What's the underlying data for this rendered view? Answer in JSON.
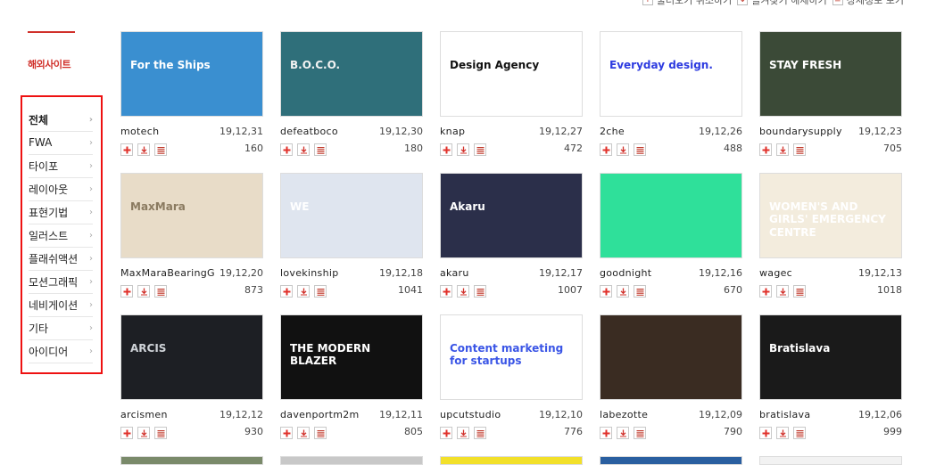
{
  "topbar": {
    "items": [
      "불러오기 취소하기",
      "즐겨찾기 해제하기",
      "상세정보 보기"
    ]
  },
  "sidebar": {
    "title": "해외사이트",
    "categories": [
      "전체",
      "FWA",
      "타이포",
      "레이아웃",
      "표현기법",
      "일러스트",
      "플래쉬액션",
      "모션그래픽",
      "네비게이션",
      "기타",
      "아이디어"
    ]
  },
  "cards": [
    {
      "name": "motech",
      "date": "19,12,31",
      "count": "160",
      "thumb": {
        "bg": "#3a8fd0",
        "text": "For the Ships",
        "fg": "#ffffff"
      }
    },
    {
      "name": "defeatboco",
      "date": "19,12,30",
      "count": "180",
      "thumb": {
        "bg": "#2f6f7a",
        "text": "B.O.C.O.",
        "fg": "#f3f3f3"
      }
    },
    {
      "name": "knap",
      "date": "19,12,27",
      "count": "472",
      "thumb": {
        "bg": "#ffffff",
        "text": "Design Agency",
        "fg": "#111111"
      }
    },
    {
      "name": "2che",
      "date": "19,12,26",
      "count": "488",
      "thumb": {
        "bg": "#ffffff",
        "text": "Everyday design.",
        "fg": "#2d3be0"
      }
    },
    {
      "name": "boundarysupply",
      "date": "19,12,23",
      "count": "705",
      "thumb": {
        "bg": "#3b4a37",
        "text": "STAY FRESH",
        "fg": "#ffffff"
      }
    },
    {
      "name": "MaxMaraBearingG..",
      "date": "19,12,20",
      "count": "873",
      "thumb": {
        "bg": "#e8dcc8",
        "text": "MaxMara",
        "fg": "#8a7a60"
      }
    },
    {
      "name": "lovekinship",
      "date": "19,12,18",
      "count": "1041",
      "thumb": {
        "bg": "#dfe5ef",
        "text": "WE",
        "fg": "#ffffff"
      }
    },
    {
      "name": "akaru",
      "date": "19,12,17",
      "count": "1007",
      "thumb": {
        "bg": "#2b2f4a",
        "text": "Akaru",
        "fg": "#ffffff"
      }
    },
    {
      "name": "goodnight",
      "date": "19,12,16",
      "count": "670",
      "thumb": {
        "bg": "#2fe09a",
        "text": "",
        "fg": "#ffffff"
      }
    },
    {
      "name": "wagec",
      "date": "19,12,13",
      "count": "1018",
      "thumb": {
        "bg": "#f3ecdd",
        "text": "WOMEN'S AND GIRLS' EMERGENCY CENTRE",
        "fg": "#ffffff"
      }
    },
    {
      "name": "arcismen",
      "date": "19,12,12",
      "count": "930",
      "thumb": {
        "bg": "#1d1f24",
        "text": "ARCIS",
        "fg": "#cfd3d8"
      }
    },
    {
      "name": "davenportm2m",
      "date": "19,12,11",
      "count": "805",
      "thumb": {
        "bg": "#111111",
        "text": "THE MODERN BLAZER",
        "fg": "#ffffff"
      }
    },
    {
      "name": "upcutstudio",
      "date": "19,12,10",
      "count": "776",
      "thumb": {
        "bg": "#ffffff",
        "text": "Content marketing for startups",
        "fg": "#3a55e6"
      }
    },
    {
      "name": "labezotte",
      "date": "19,12,09",
      "count": "790",
      "thumb": {
        "bg": "#3a2c22",
        "text": "",
        "fg": "#ffffff"
      }
    },
    {
      "name": "bratislava",
      "date": "19,12,06",
      "count": "999",
      "thumb": {
        "bg": "#1a1a1a",
        "text": "Bratislava",
        "fg": "#ffffff"
      }
    }
  ],
  "partial_row_colors": [
    "#7a8a6a",
    "#c8c8c8",
    "#f2e02a",
    "#2a5fa0",
    "#f2f2f2"
  ],
  "colors": {
    "accent": "#d0302a",
    "plus": "#e0302a",
    "download": "#d0302a",
    "list": "#c0392b"
  }
}
